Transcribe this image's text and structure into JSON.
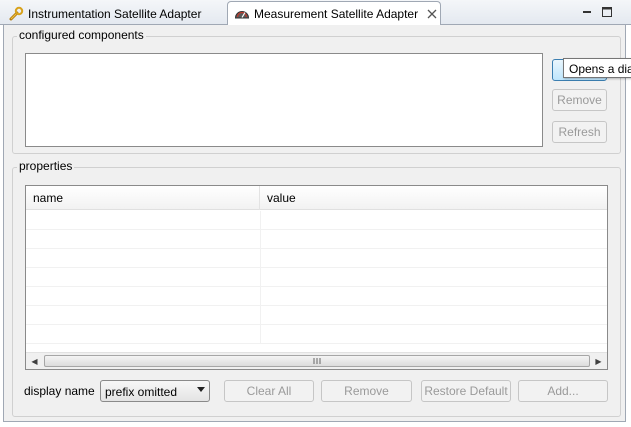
{
  "tabs": [
    {
      "label": "Instrumentation Satellite Adapter",
      "active": false,
      "icon": "wrench-icon"
    },
    {
      "label": "Measurement Satellite Adapter",
      "active": true,
      "icon": "gauge-icon"
    }
  ],
  "window_controls": {
    "minimize": "minimize-icon",
    "maximize": "maximize-icon"
  },
  "configured_components": {
    "label": "configured components",
    "items": [],
    "buttons": {
      "add": "Add...",
      "remove": "Remove",
      "refresh": "Refresh"
    },
    "tooltip": "Opens a dialog"
  },
  "properties": {
    "label": "properties",
    "columns": [
      "name",
      "value"
    ],
    "rows": [],
    "display_name_label": "display name",
    "display_name_value": "prefix omitted",
    "buttons": {
      "clear_all": "Clear All",
      "remove": "Remove",
      "restore_default": "Restore Default",
      "add": "Add..."
    }
  },
  "colors": {
    "accent": "#3c7fb1",
    "panel": "#f0f0f0",
    "disabled_text": "#9a9a9a"
  }
}
